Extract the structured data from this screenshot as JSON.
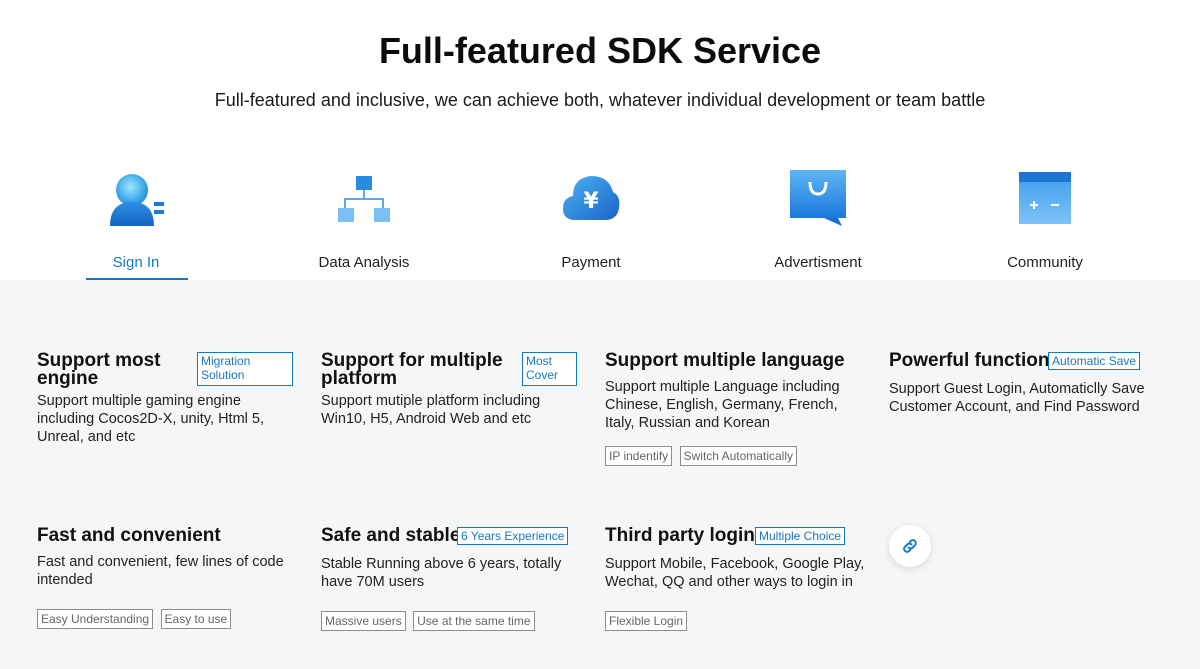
{
  "header": {
    "title": "Full-featured SDK Service",
    "subtitle": "Full-featured and inclusive, we can achieve both, whatever individual development or team battle"
  },
  "tabs": [
    {
      "label": "Sign In",
      "icon": "user-sign-in-icon",
      "active": true
    },
    {
      "label": "Data Analysis",
      "icon": "data-tree-icon",
      "active": false
    },
    {
      "label": "Payment",
      "icon": "yen-cloud-icon",
      "active": false
    },
    {
      "label": "Advertisment",
      "icon": "ad-screen-icon",
      "active": false
    },
    {
      "label": "Community",
      "icon": "community-calculator-icon",
      "active": false
    }
  ],
  "features": [
    {
      "title": "Support most engine",
      "title_line1": "Support most",
      "title_line2": "engine",
      "badge": "Migration Solution",
      "badge_line1": "Migration",
      "badge_line2": "Solution",
      "desc": "Support multiple gaming engine including Cocos2D-X, unity, Html 5, Unreal, and etc",
      "tags": []
    },
    {
      "title": "Support for multiple platform",
      "title_line1": "Support for multiple",
      "title_line2": "platform",
      "badge": "Most Cover",
      "badge_line1": "Most",
      "badge_line2": "Cover",
      "desc": "Support mutiple platform including Win10, H5, Android Web and etc",
      "tags": []
    },
    {
      "title": "Support multiple language",
      "badge": "",
      "desc": "Support multiple Language including Chinese, English, Germany, French, Italy, Russian and Korean",
      "tags": [
        "IP indentify",
        "Switch Automatically"
      ]
    },
    {
      "title": "Powerful function",
      "badge": "Automatic Save",
      "desc": "Support Guest Login, Automaticlly Save Customer Account, and Find Password",
      "tags": []
    },
    {
      "title": "Fast and convenient",
      "badge": "",
      "desc": "Fast and convenient, few lines of code intended",
      "tags": [
        "Easy Understanding",
        "Easy to use"
      ]
    },
    {
      "title": "Safe and stable",
      "badge": "6 Years Experience",
      "desc": "Stable Running above 6 years, totally have 70M users",
      "tags": [
        "Massive users",
        "Use at the same time"
      ]
    },
    {
      "title": "Third party login",
      "badge": "Multiple Choice",
      "desc": "Support Mobile, Facebook, Google Play, Wechat, QQ and other ways to login in",
      "tags": [
        "Flexible Login"
      ]
    }
  ],
  "colors": {
    "accent": "#1677c8",
    "section_bg": "#f5f6f8"
  },
  "link_button": {
    "icon": "link-icon"
  }
}
